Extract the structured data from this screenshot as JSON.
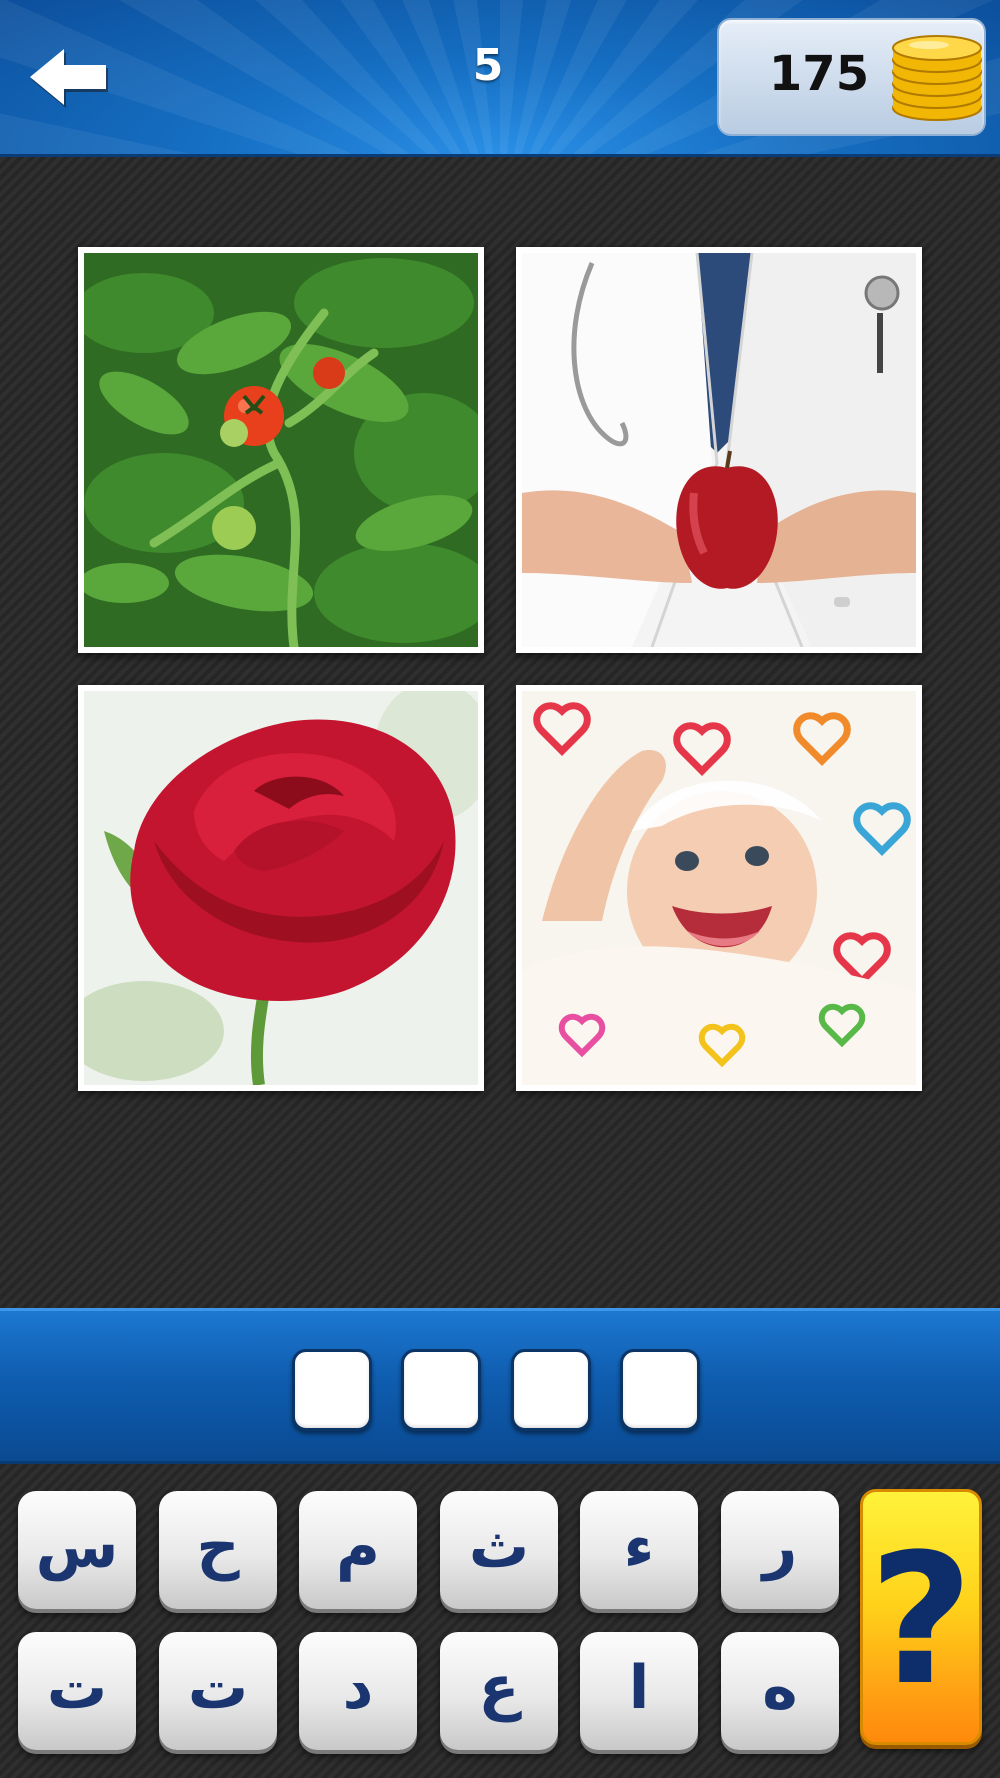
{
  "header": {
    "back_icon": "arrow-left-icon",
    "level": "5",
    "coins": "175",
    "coins_icon": "coin-stack-icon"
  },
  "pictures": [
    {
      "subject": "tomato-plant-image"
    },
    {
      "subject": "doctor-with-apple-image"
    },
    {
      "subject": "red-rose-image"
    },
    {
      "subject": "smiling-baby-image"
    }
  ],
  "answer": {
    "slots": [
      "",
      "",
      "",
      ""
    ]
  },
  "keyboard": {
    "row1": [
      "س",
      "ح",
      "م",
      "ث",
      "ء",
      "ر"
    ],
    "row2": [
      "ت",
      "ت",
      "د",
      "ع",
      "ا",
      "ه"
    ],
    "hint_label": "?"
  },
  "colors": {
    "header_blue": "#1670c4",
    "key_text": "#1a3570",
    "hint_yellow": "#ffd21a",
    "hint_orange": "#ff8a0c"
  }
}
